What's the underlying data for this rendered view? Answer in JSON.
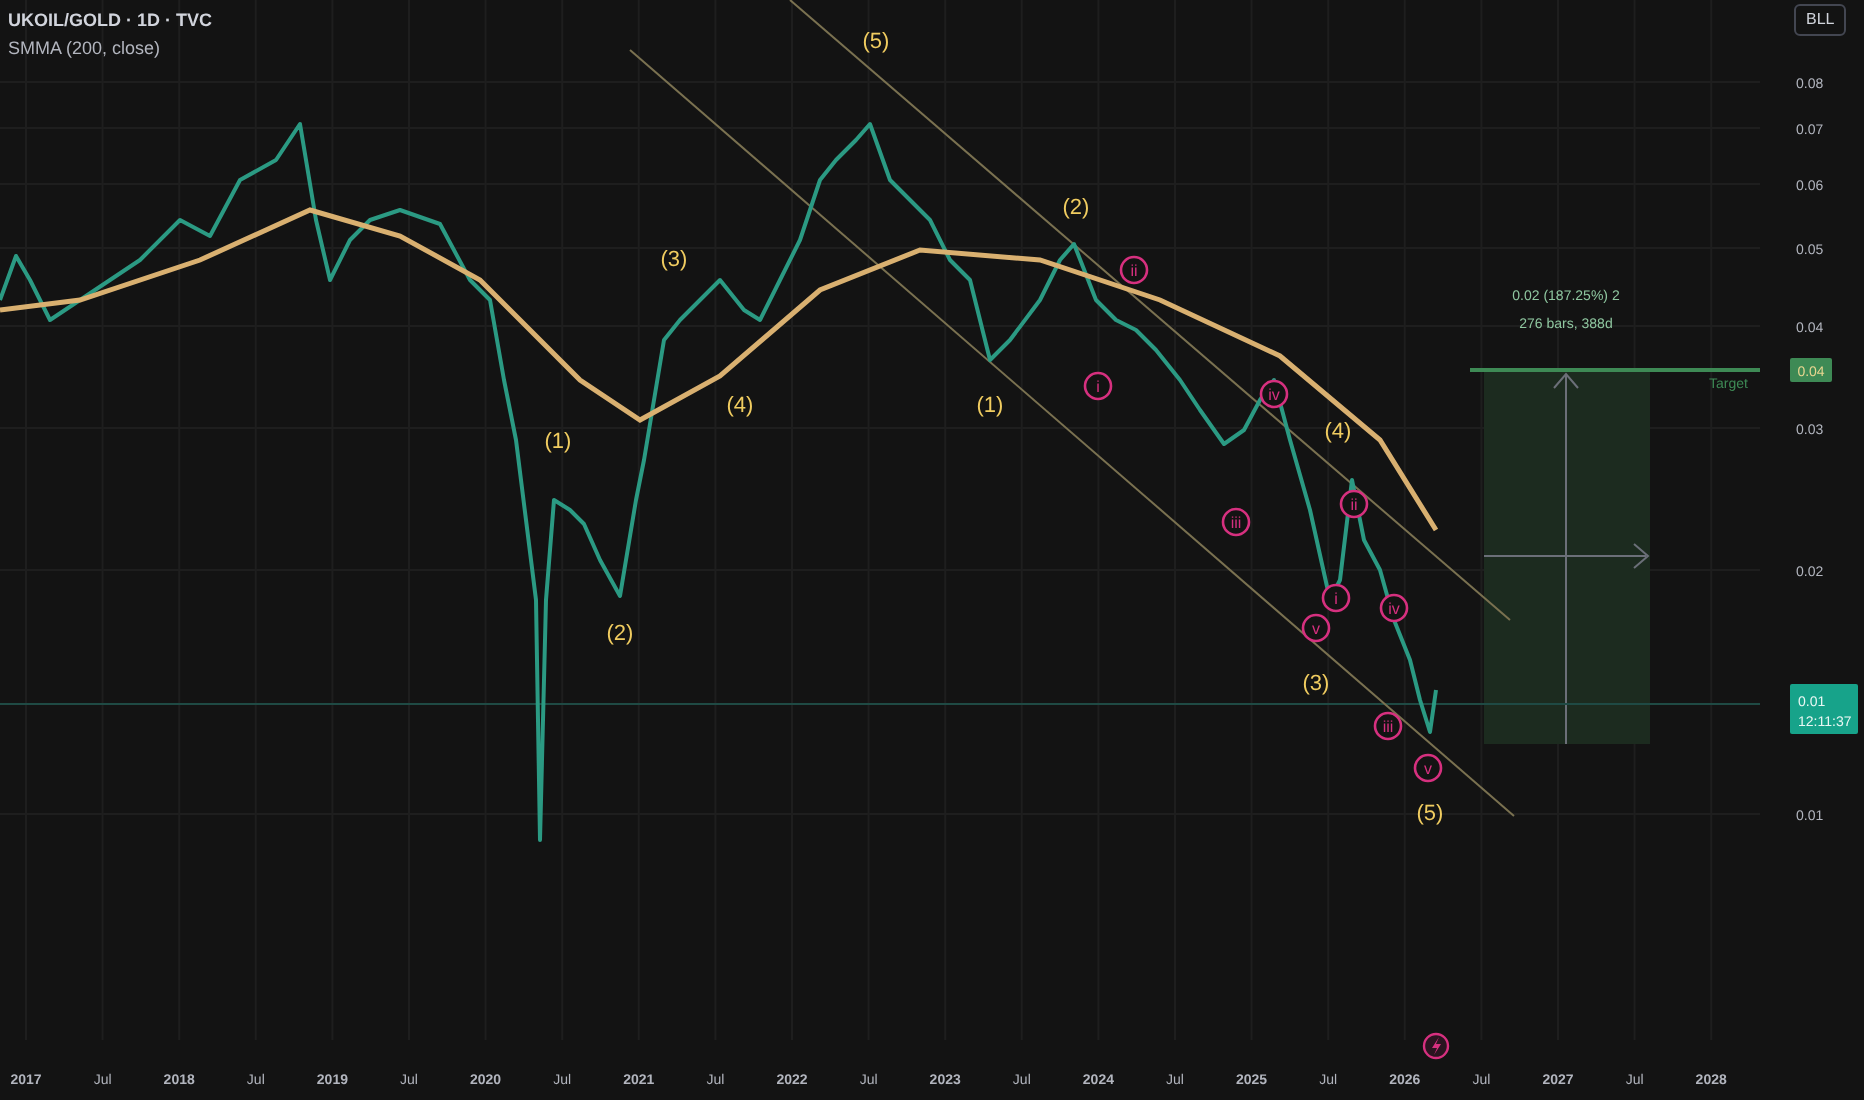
{
  "header": {
    "symbol": "UKOIL/GOLD · 1D · TVC",
    "indicator": "SMMA (200, close)"
  },
  "toolbar_button": "BLL",
  "price_axis": [
    "0.08",
    "0.07",
    "0.06",
    "0.05",
    "0.04",
    "0.03",
    "0.02",
    "0.01"
  ],
  "target": {
    "label": "Target",
    "badge": "0.04"
  },
  "current_price": {
    "price": "0.01",
    "countdown": "12:11:37"
  },
  "measure": {
    "change": "0.02 (187.25%) 2",
    "range": "276 bars, 388d"
  },
  "time_axis": [
    "2017",
    "Jul",
    "2018",
    "Jul",
    "2019",
    "Jul",
    "2020",
    "Jul",
    "2021",
    "Jul",
    "2022",
    "Jul",
    "2023",
    "Jul",
    "2024",
    "Jul",
    "2025",
    "Jul",
    "2026",
    "Jul",
    "2027",
    "Jul",
    "2028"
  ],
  "wave_labels": [
    {
      "text": "(5)",
      "kind": "paren"
    },
    {
      "text": "(3)",
      "kind": "paren"
    },
    {
      "text": "(4)",
      "kind": "paren"
    },
    {
      "text": "(1)",
      "kind": "paren"
    },
    {
      "text": "(2)",
      "kind": "paren"
    },
    {
      "text": "(2)",
      "kind": "paren"
    },
    {
      "text": "(1)",
      "kind": "paren"
    },
    {
      "text": "(4)",
      "kind": "paren"
    },
    {
      "text": "(3)",
      "kind": "paren"
    },
    {
      "text": "(5)",
      "kind": "paren"
    },
    {
      "text": "ii",
      "kind": "circle"
    },
    {
      "text": "i",
      "kind": "circle"
    },
    {
      "text": "iv",
      "kind": "circle"
    },
    {
      "text": "iii",
      "kind": "circle"
    },
    {
      "text": "ii",
      "kind": "circle"
    },
    {
      "text": "i",
      "kind": "circle"
    },
    {
      "text": "v",
      "kind": "circle"
    },
    {
      "text": "iv",
      "kind": "circle"
    },
    {
      "text": "iii",
      "kind": "circle"
    },
    {
      "text": "v",
      "kind": "circle"
    }
  ]
}
